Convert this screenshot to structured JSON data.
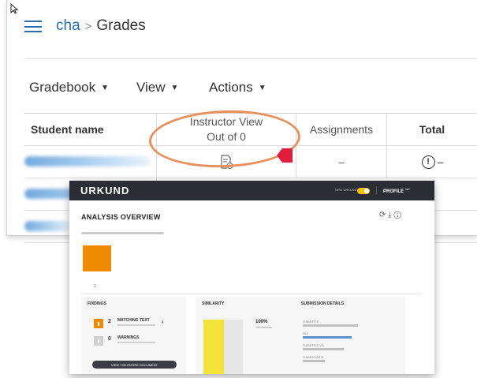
{
  "breadcrumb": {
    "course": "cha",
    "separator": ">",
    "page": "Grades"
  },
  "toolbar": {
    "gradebook": "Gradebook",
    "view": "View",
    "actions": "Actions"
  },
  "table": {
    "headers": {
      "student": "Student name",
      "instructor_line1": "Instructor View",
      "instructor_line2": "Out of 0",
      "assignments": "Assignments",
      "total": "Total"
    },
    "row1": {
      "assignments": "–",
      "total_icon": "!",
      "total": "–"
    }
  },
  "urkund": {
    "brand": "URKUND",
    "toggle_label": "NEW URKUND",
    "profile": "PROFILE",
    "title": "ANALYSIS OVERVIEW",
    "doc_number": "1",
    "findings": {
      "heading": "FINDINGS",
      "matching_count": "2",
      "matching_label": "MATCHING TEXT",
      "warnings_count": "0",
      "warnings_label": "WARNINGS",
      "view_button": "VIEW THE ENTIRE DOCUMENT"
    },
    "similarity": {
      "heading": "SIMILARITY",
      "percent": "100%",
      "label": "Text matches"
    },
    "submission": {
      "heading": "SUBMISSION DETAILS",
      "submitted_by_label": "SUBMITTED",
      "file_label": "FILE",
      "submitted_via_label": "SUBMITTED VIA",
      "submission_id_label": "SUBMISSION ID"
    },
    "accent_orange": "#f08a00",
    "accent_yellow": "#f4e23c"
  },
  "icons": {
    "cursor": "cursor-arrow-icon",
    "menu": "hamburger-menu-icon",
    "grade_doc": "document-clock-icon",
    "alert": "exclamation-circle-icon"
  }
}
